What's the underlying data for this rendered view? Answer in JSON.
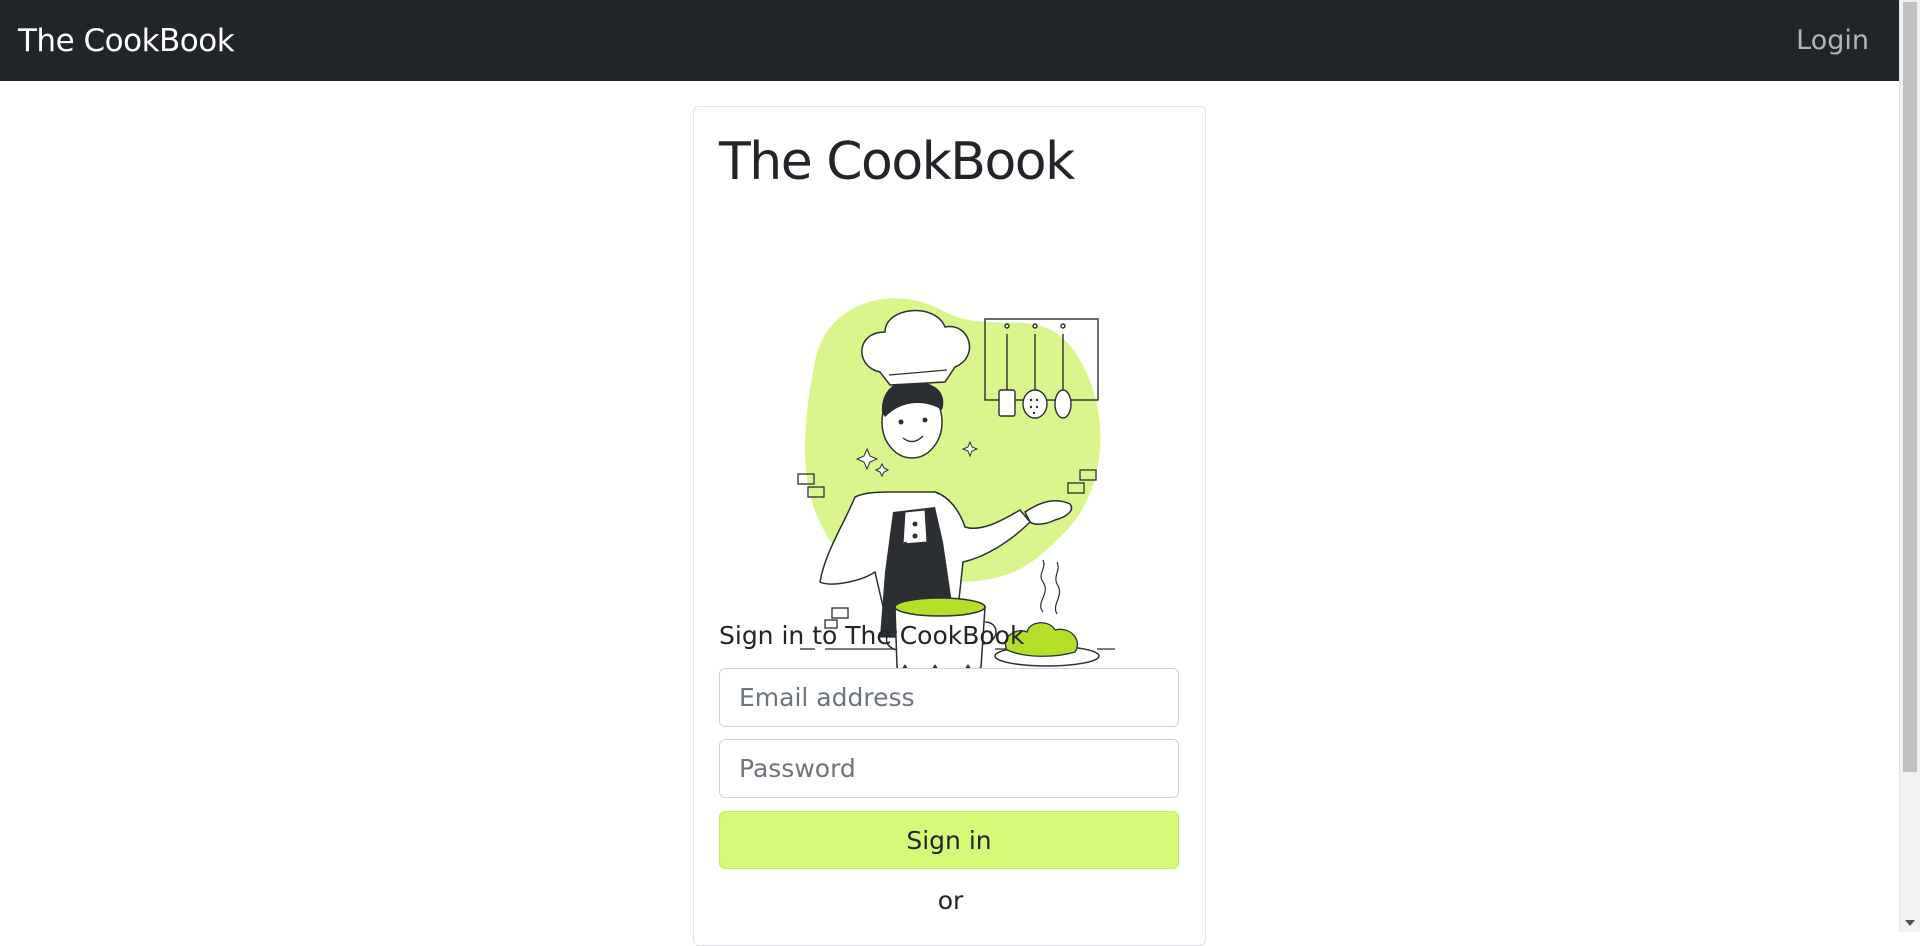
{
  "navbar": {
    "brand": "The CookBook",
    "login_label": "Login"
  },
  "card": {
    "title": "The CookBook",
    "illustration_icon": "chef-cooking-illustration",
    "signin_heading": "Sign in to The CookBook",
    "email_placeholder": "Email address",
    "password_placeholder": "Password",
    "signin_button": "Sign in",
    "or_text": "or"
  },
  "colors": {
    "navbar_bg": "#212529",
    "accent": "#d4fa78",
    "illustration_blob": "#d9f58c",
    "illustration_green": "#b5e02a"
  }
}
